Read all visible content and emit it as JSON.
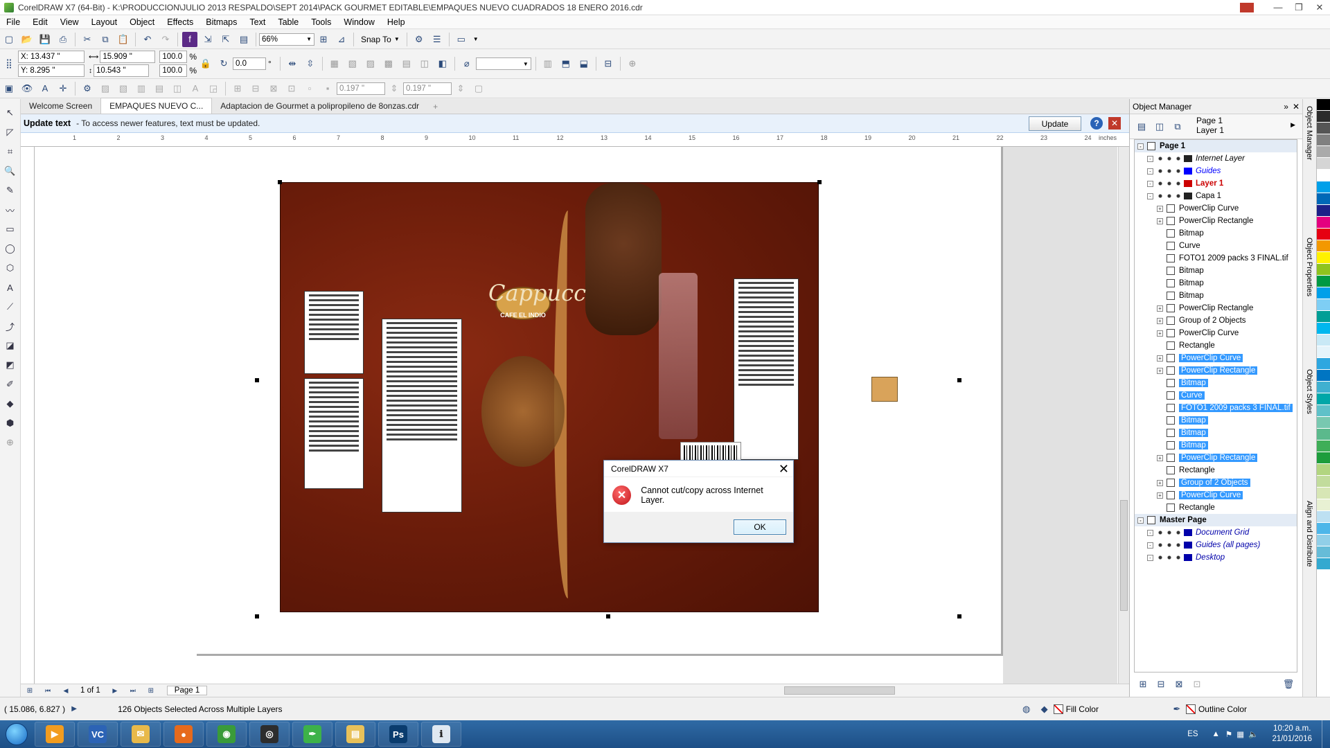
{
  "window": {
    "title": "CorelDRAW X7 (64-Bit) - K:\\PRODUCCION\\JULIO 2013 RESPALDO\\SEPT 2014\\PACK GOURMET EDITABLE\\EMPAQUES NUEVO CUADRADOS 18 ENERO 2016.cdr",
    "minimize": "—",
    "restore": "❐",
    "close": "✕"
  },
  "menu": [
    "File",
    "Edit",
    "View",
    "Layout",
    "Object",
    "Effects",
    "Bitmaps",
    "Text",
    "Table",
    "Tools",
    "Window",
    "Help"
  ],
  "toolbar": {
    "zoom": "66%",
    "snap_to": "Snap To"
  },
  "property_bar": {
    "x": "X: 13.437 \"",
    "y": "Y: 8.295 \"",
    "width": "15.909 \"",
    "height": "10.543 \"",
    "scale_x": "100.0",
    "scale_y": "100.0",
    "percent": "%",
    "rotation": "0.0",
    "degree": "°",
    "nudge1": "0.197 \"",
    "nudge2": "0.197 \""
  },
  "tabs": [
    "Welcome Screen",
    "EMPAQUES NUEVO C...",
    "Adaptacion de Gourmet a polipropileno de 8onzas.cdr"
  ],
  "tab_add": "+",
  "notice": {
    "title": "Update text",
    "message": "-  To access newer features, text must be updated.",
    "button": "Update",
    "help": "?",
    "close": "✕"
  },
  "ruler": {
    "unit": "inches",
    "ticks": [
      "1",
      "2",
      "3",
      "4",
      "5",
      "6",
      "7",
      "8",
      "9",
      "10",
      "11",
      "12",
      "13",
      "14",
      "15",
      "16",
      "17",
      "18",
      "19",
      "20",
      "21",
      "22",
      "23",
      "24"
    ]
  },
  "artwork": {
    "brand": "Cappucc",
    "logo": "CAFE EL INDIO"
  },
  "dialog": {
    "title": "CorelDRAW X7",
    "icon": "✕",
    "message": "Cannot cut/copy across Internet Layer.",
    "ok": "OK",
    "close": "✕"
  },
  "page_nav": {
    "count": "1 of 1",
    "page_tab": "Page 1"
  },
  "status": {
    "coords": "( 15.086, 6.827 )",
    "message": "126 Objects Selected Across Multiple Layers",
    "fill": "Fill Color",
    "outline": "Outline Color"
  },
  "object_manager": {
    "title": "Object Manager",
    "page": "Page 1",
    "layer": "Layer 1",
    "rows": [
      {
        "label": "Page 1",
        "level": 0,
        "type": "page"
      },
      {
        "label": "Internet Layer",
        "level": 1,
        "type": "layer",
        "italic": true
      },
      {
        "label": "Guides",
        "level": 1,
        "type": "layer",
        "italic": true,
        "color": "#0000ff"
      },
      {
        "label": "Layer 1",
        "level": 1,
        "type": "layer",
        "color": "#cc0000",
        "bold": true
      },
      {
        "label": "Capa 1",
        "level": 1,
        "type": "layer"
      },
      {
        "label": "PowerClip Curve",
        "level": 2,
        "type": "obj"
      },
      {
        "label": "PowerClip Rectangle",
        "level": 2,
        "type": "obj"
      },
      {
        "label": "Bitmap",
        "level": 2,
        "type": "obj"
      },
      {
        "label": "Curve",
        "level": 2,
        "type": "obj"
      },
      {
        "label": "FOTO1 2009 packs 3 FINAL.tif",
        "level": 2,
        "type": "obj"
      },
      {
        "label": "Bitmap",
        "level": 2,
        "type": "obj"
      },
      {
        "label": "Bitmap",
        "level": 2,
        "type": "obj"
      },
      {
        "label": "Bitmap",
        "level": 2,
        "type": "obj"
      },
      {
        "label": "PowerClip Rectangle",
        "level": 2,
        "type": "obj"
      },
      {
        "label": "Group of 2 Objects",
        "level": 2,
        "type": "obj"
      },
      {
        "label": "PowerClip Curve",
        "level": 2,
        "type": "obj"
      },
      {
        "label": "Rectangle",
        "level": 2,
        "type": "obj"
      },
      {
        "label": "PowerClip Curve",
        "level": 2,
        "type": "obj",
        "selected": true
      },
      {
        "label": "PowerClip Rectangle",
        "level": 2,
        "type": "obj",
        "selected": true
      },
      {
        "label": "Bitmap",
        "level": 2,
        "type": "obj",
        "selected": true
      },
      {
        "label": "Curve",
        "level": 2,
        "type": "obj",
        "selected": true
      },
      {
        "label": "FOTO1 2009 packs 3 FINAL.tif",
        "level": 2,
        "type": "obj",
        "selected": true
      },
      {
        "label": "Bitmap",
        "level": 2,
        "type": "obj",
        "selected": true
      },
      {
        "label": "Bitmap",
        "level": 2,
        "type": "obj",
        "selected": true
      },
      {
        "label": "Bitmap",
        "level": 2,
        "type": "obj",
        "selected": true
      },
      {
        "label": "PowerClip Rectangle",
        "level": 2,
        "type": "obj",
        "selected": true
      },
      {
        "label": "Rectangle",
        "level": 2,
        "type": "obj"
      },
      {
        "label": "Group of 2 Objects",
        "level": 2,
        "type": "obj",
        "selected": true
      },
      {
        "label": "PowerClip Curve",
        "level": 2,
        "type": "obj",
        "selected": true
      },
      {
        "label": "Rectangle",
        "level": 2,
        "type": "obj"
      },
      {
        "label": "Master Page",
        "level": 0,
        "type": "page"
      },
      {
        "label": "Document Grid",
        "level": 1,
        "type": "layer",
        "italic": true,
        "color": "#0000aa"
      },
      {
        "label": "Guides (all pages)",
        "level": 1,
        "type": "layer",
        "italic": true,
        "color": "#0000aa"
      },
      {
        "label": "Desktop",
        "level": 1,
        "type": "layer",
        "italic": true,
        "color": "#0000aa"
      }
    ]
  },
  "dockers": [
    "Object Manager",
    "Object Properties",
    "Object Styles",
    "Align and Distribute"
  ],
  "palette": [
    "#000000",
    "#2b2b2b",
    "#555555",
    "#808080",
    "#aaaaaa",
    "#d5d5d5",
    "#ffffff",
    "#00a0e9",
    "#0068b7",
    "#1d2088",
    "#e4007f",
    "#e60012",
    "#f39800",
    "#fff100",
    "#8fc31f",
    "#009944",
    "#00a0e9",
    "#7ecef4",
    "#009e96",
    "#00b7ee",
    "#c9e9f6",
    "#e5f4fb",
    "#2ea7e0",
    "#0075c2",
    "#40b0d0",
    "#00a7a8",
    "#5fc1c9",
    "#78c8b0",
    "#5bb98c",
    "#3fae57",
    "#1d9d3c",
    "#b2d580",
    "#c2dc9c",
    "#d7e6b5",
    "#e8f1d3",
    "#bde0f2",
    "#4db6e9",
    "#91cfe8",
    "#66bcd8",
    "#33a9d0"
  ],
  "taskbar": {
    "apps": [
      {
        "label": "Media Player",
        "color": "#f29c1f",
        "glyph": "▶"
      },
      {
        "label": "VC",
        "color": "#2c63b5",
        "glyph": "VC"
      },
      {
        "label": "Outlook",
        "color": "#e8b94a",
        "glyph": "✉"
      },
      {
        "label": "Firefox",
        "color": "#e66a1c",
        "glyph": "●"
      },
      {
        "label": "Chrome",
        "color": "#3a9b3a",
        "glyph": "◉"
      },
      {
        "label": "Camera",
        "color": "#2d2d2d",
        "glyph": "◎"
      },
      {
        "label": "CorelDRAW",
        "color": "#3db249",
        "glyph": "✒"
      },
      {
        "label": "Explorer",
        "color": "#e8c15a",
        "glyph": "▤"
      },
      {
        "label": "Photoshop",
        "color": "#0a3c6e",
        "glyph": "Ps"
      },
      {
        "label": "Task",
        "color": "#dfe8f1",
        "glyph": "ℹ"
      }
    ],
    "lang": "ES",
    "time": "10:20 a.m.",
    "date": "21/01/2016"
  }
}
